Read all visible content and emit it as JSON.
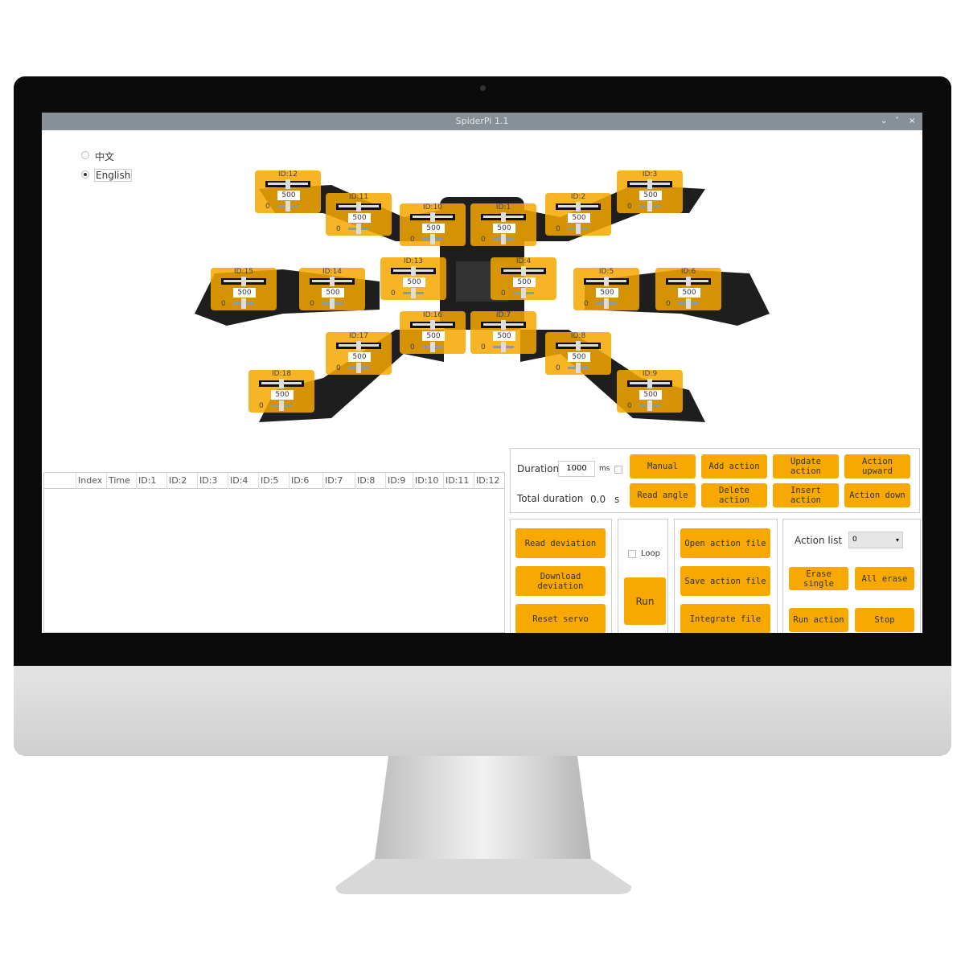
{
  "window": {
    "title": "SpiderPi 1.1",
    "controls": [
      "⌄",
      "˄",
      "×"
    ]
  },
  "language": {
    "options": [
      {
        "label": "中文",
        "selected": false
      },
      {
        "label": "English",
        "selected": true
      }
    ]
  },
  "servos": [
    {
      "label": "ID:12",
      "value": "500",
      "min": "0"
    },
    {
      "label": "ID:11",
      "value": "500",
      "min": "0"
    },
    {
      "label": "ID:10",
      "value": "500",
      "min": "0"
    },
    {
      "label": "ID:1",
      "value": "500",
      "min": "0"
    },
    {
      "label": "ID:2",
      "value": "500",
      "min": "0"
    },
    {
      "label": "ID:3",
      "value": "500",
      "min": "0"
    },
    {
      "label": "ID:15",
      "value": "500",
      "min": "0"
    },
    {
      "label": "ID:14",
      "value": "500",
      "min": "0"
    },
    {
      "label": "ID:13",
      "value": "500",
      "min": "0"
    },
    {
      "label": "ID:4",
      "value": "500",
      "min": "0"
    },
    {
      "label": "ID:5",
      "value": "500",
      "min": "0"
    },
    {
      "label": "ID:6",
      "value": "500",
      "min": "0"
    },
    {
      "label": "ID:16",
      "value": "500",
      "min": "0"
    },
    {
      "label": "ID:7",
      "value": "500",
      "min": "0"
    },
    {
      "label": "ID:17",
      "value": "500",
      "min": "0"
    },
    {
      "label": "ID:8",
      "value": "500",
      "min": "0"
    },
    {
      "label": "ID:18",
      "value": "500",
      "min": "0"
    },
    {
      "label": "ID:9",
      "value": "500",
      "min": "0"
    }
  ],
  "table": {
    "columns": [
      "Index",
      "Time",
      "ID:1",
      "ID:2",
      "ID:3",
      "ID:4",
      "ID:5",
      "ID:6",
      "ID:7",
      "ID:8",
      "ID:9",
      "ID:10",
      "ID:11",
      "ID:12"
    ]
  },
  "controls": {
    "duration_label": "Duration",
    "duration_value": "1000",
    "duration_unit": "ms",
    "total_label": "Total duration",
    "total_value": "0.0",
    "total_unit": "s",
    "manual": "Manual",
    "add_action": "Add action",
    "update_action": "Update action",
    "action_upward": "Action upward",
    "read_angle": "Read angle",
    "delete_action": "Delete action",
    "insert_action": "Insert action",
    "action_down": "Action down",
    "read_deviation": "Read deviation",
    "download_deviation": "Download deviation",
    "reset_servo": "Reset servo",
    "loop": "Loop",
    "run": "Run",
    "open_action_file": "Open action file",
    "save_action_file": "Save action file",
    "integrate_file": "Integrate file",
    "action_list_label": "Action list",
    "action_list_value": "0",
    "erase_single": "Erase single",
    "all_erase": "All erase",
    "run_action": "Run action",
    "stop": "Stop"
  },
  "colors": {
    "accent": "#f8a900",
    "titlebar": "#878f97"
  }
}
